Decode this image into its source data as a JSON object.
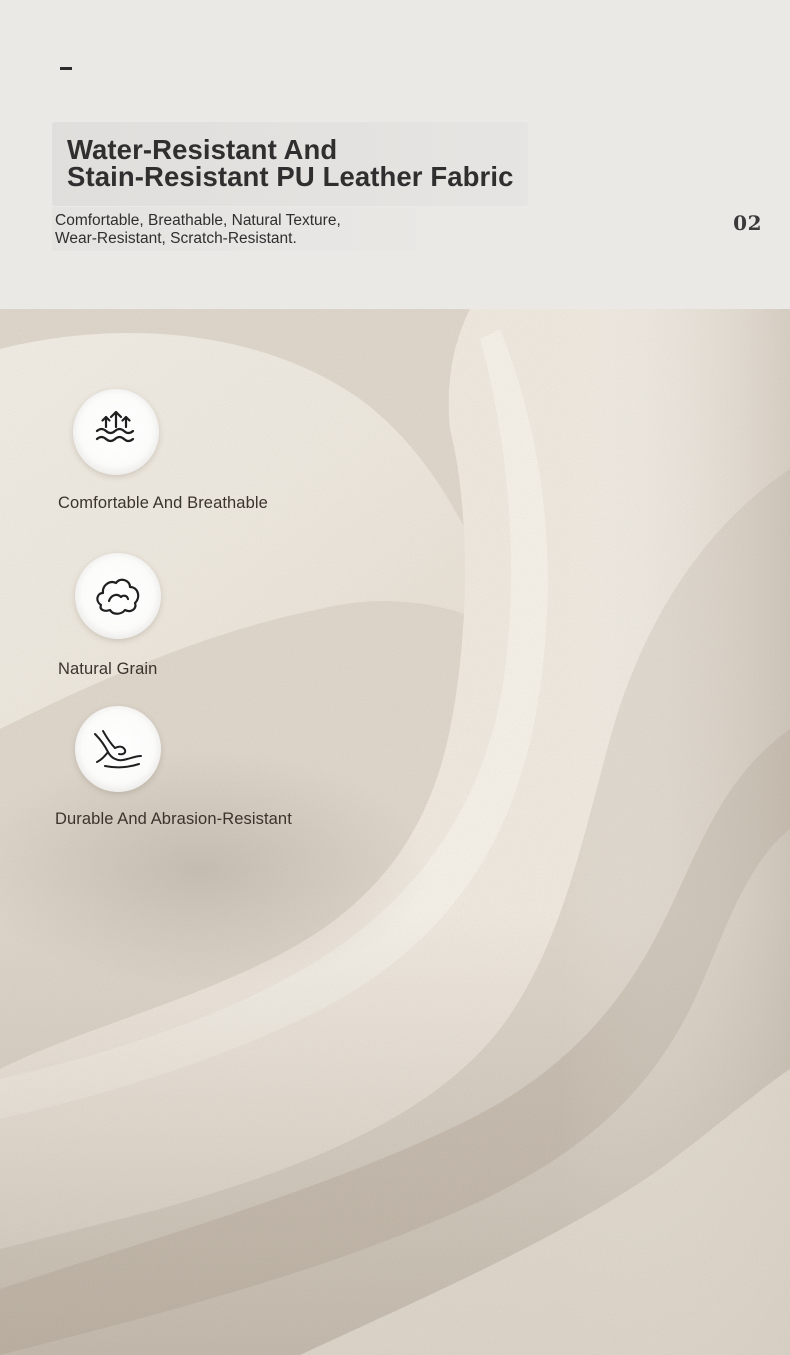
{
  "header": {
    "title_line1": "Water-Resistant And",
    "title_line2": "Stain-Resistant PU Leather Fabric",
    "subtitle_line1": "Comfortable, Breathable, Natural Texture,",
    "subtitle_line2": "Wear-Resistant, Scratch-Resistant.",
    "page_number": "02"
  },
  "features": [
    {
      "icon": "water-vapor-icon",
      "label": "Comfortable And Breathable"
    },
    {
      "icon": "leather-grain-icon",
      "label": "Natural Grain"
    },
    {
      "icon": "hand-scratch-icon",
      "label": "Durable And Abrasion-Resistant"
    }
  ],
  "colors": {
    "header_background": "#ebe9e6",
    "text": "#2f2f2f",
    "leather": "#e6dfd4"
  }
}
